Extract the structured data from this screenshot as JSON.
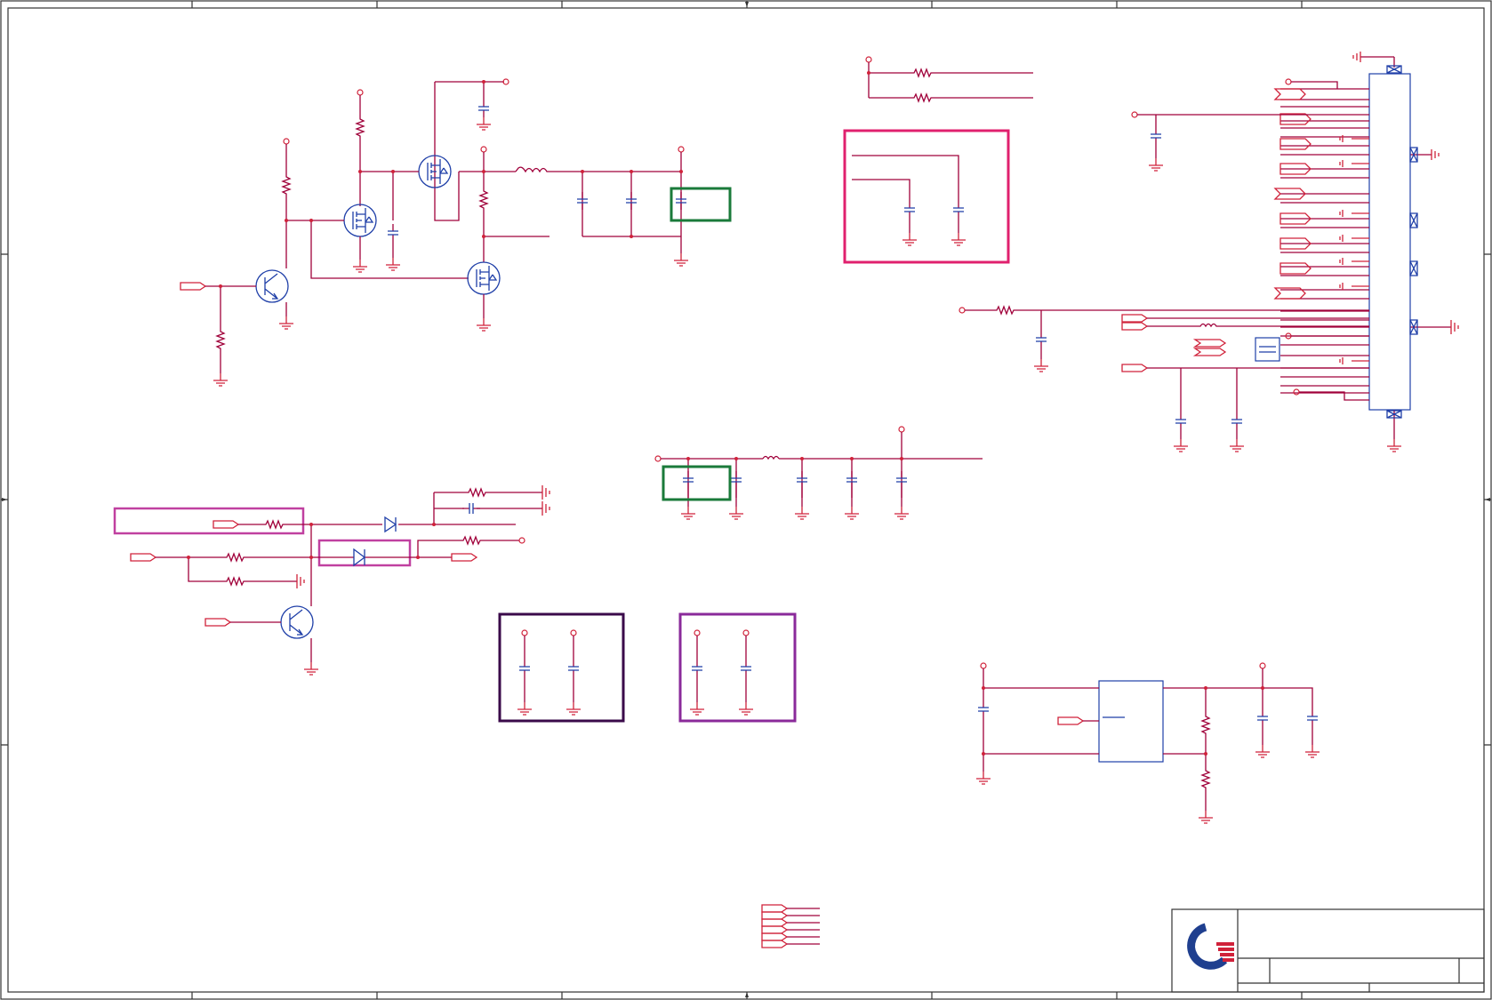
{
  "document": {
    "type": "schematic-sheet",
    "title_block": {
      "logo_icon": "company-logo",
      "brand_colors": [
        "#1f3f8f",
        "#d0223a"
      ]
    }
  },
  "colors": {
    "wire": "#a0003a",
    "component": "#1f3fa8",
    "ground": "#d0223a",
    "box_magenta": "#e0206e",
    "box_green": "#1a7a3a",
    "box_purple": "#8a2a9a",
    "box_dark": "#3a0a4a",
    "frame": "#333333"
  }
}
